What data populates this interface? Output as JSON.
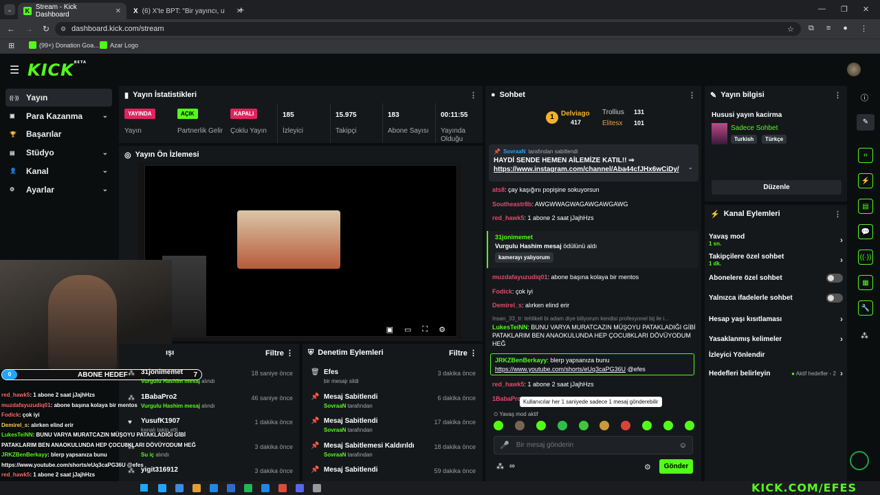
{
  "browser": {
    "tabs": [
      {
        "label": "Stream - Kick Dashboard"
      },
      {
        "label": "(6) X'te BPT: \"Bir yayıncı, uyuma"
      }
    ],
    "url": "dashboard.kick.com/stream",
    "bookmarks": [
      "(99+) Donation Goa...",
      "Azar Logo"
    ]
  },
  "brand": {
    "logo": "KICK",
    "beta": "BETA",
    "accent": "#53fc18"
  },
  "sidebar": {
    "items": [
      {
        "label": "Yayın",
        "icon": "broadcast-icon",
        "active": true,
        "expand": false
      },
      {
        "label": "Para Kazanma",
        "icon": "money-icon",
        "expand": true
      },
      {
        "label": "Başarılar",
        "icon": "trophy-icon",
        "expand": false
      },
      {
        "label": "Stüdyo",
        "icon": "studio-icon",
        "expand": true
      },
      {
        "label": "Kanal",
        "icon": "user-icon",
        "expand": true
      },
      {
        "label": "Ayarlar",
        "icon": "gear-icon",
        "expand": true
      }
    ]
  },
  "stats": {
    "title": "Yayın İstatistikleri",
    "items": [
      {
        "badge": "YAYINDA",
        "label": "Yayın",
        "badge_color": "#e0245e"
      },
      {
        "badge": "AÇIK",
        "label": "Partnerlik Gelir",
        "badge_color": "#53fc18"
      },
      {
        "badge": "KAPALI",
        "label": "Çoklu Yayın",
        "badge_color": "#e0245e"
      },
      {
        "value": "185",
        "label": "İzleyici"
      },
      {
        "value": "15.975",
        "label": "Takipçi"
      },
      {
        "value": "183",
        "label": "Abone Sayısı"
      },
      {
        "value": "00:11:55",
        "label": "Yayında Olduğu"
      }
    ]
  },
  "preview": {
    "title": "Yayın Ön İzlemesi"
  },
  "activity": {
    "title": "ışı",
    "filter": "Filtre",
    "rows": [
      {
        "user": "31jonimemet",
        "detail_hl": "Vurgulu Hashim mesaj",
        "detail": " alındı",
        "time": "18 saniye önce"
      },
      {
        "user": "1BabaPro2",
        "detail_hl": "Vurgulu Hashim mesaj",
        "detail": " alındı",
        "time": "46 saniye önce"
      },
      {
        "user": "YusufK1907",
        "detail_hl": "",
        "detail": "kanalı takip etti",
        "time": "1 dakika önce"
      },
      {
        "user": "",
        "detail_hl": "Su iç",
        "detail": " alındı",
        "time": "3 dakika önce"
      },
      {
        "user": "yigit316912",
        "detail_hl": "",
        "detail": "",
        "time": "3 dakika önce"
      }
    ]
  },
  "moderation": {
    "title": "Denetim Eylemleri",
    "filter": "Filtre",
    "rows": [
      {
        "title": "Efes",
        "sub_hl": "",
        "sub": "bir mesajı sildi",
        "time": "3 dakika önce"
      },
      {
        "title": "Mesaj Sabitlendi",
        "sub_hl": "SovraaN",
        "sub": " tarafından",
        "time": "6 dakika önce"
      },
      {
        "title": "Mesaj Sabitlendi",
        "sub_hl": "SovraaN",
        "sub": " tarafından",
        "time": "17 dakika önce"
      },
      {
        "title": "Mesaj Sabitlemesi Kaldırıldı",
        "sub_hl": "SovraaN",
        "sub": " tarafından",
        "time": "18 dakika önce"
      },
      {
        "title": "Mesaj Sabitlendi",
        "sub_hl": "",
        "sub": "",
        "time": "59 dakika önce"
      }
    ]
  },
  "chat": {
    "title": "Sohbet",
    "leaders": [
      {
        "rank": "1",
        "name": "Delviago",
        "count": "417"
      },
      {
        "name": "Trollius",
        "count": "131"
      },
      {
        "name": "Elitesx",
        "count": "101"
      }
    ],
    "pinned_by": "SovraaN",
    "pinned_by_suffix": " tarafından sabitlendi",
    "pinned_text": "HAYDİ SENDE HEMEN AİLEMİZE KATIL!! ⇒",
    "pinned_link": "https://www.instagram.com/channel/Aba44cfJHx6wCiDy/",
    "messages": [
      {
        "user": "ats8",
        "color": "#e04a6c",
        "text": "çay kaşığını popişine sokuyorsun"
      },
      {
        "user": "Southeastr8b",
        "color": "#e04a6c",
        "text": "AWGWWAGWAGAWGAWGAWG"
      },
      {
        "user": "red_hawk5",
        "color": "#e04a6c",
        "text": "1 abone 2 saat jJajhHzs"
      }
    ],
    "highlight_user": "31jonimemet",
    "highlight_text": "Vurgulu Hashim mesaj",
    "highlight_suffix": " ödülünü aldı",
    "highlight_tag": "kamerayı yalıyorum",
    "messages2": [
      {
        "user": "muzdafayuzudiq01",
        "color": "#e04a6c",
        "text": "abone başına kolaya bir mentos"
      },
      {
        "user": "Fodick",
        "color": "#e04a6c",
        "text": "çok iyi"
      },
      {
        "user": "Demirel_s",
        "color": "#e04a6c",
        "text": "alırken elind erir"
      }
    ],
    "reply_ref": "Insan_33_tr: tehlikeli bi adam diye biliyorum kendisi profesyonel bij ile i...",
    "reply_user": "LukesTeiNN",
    "reply_text": "BUNU VARYA MURATCAZIN MÜŞOYU PATAKLADIĞI GİBİ PATAKLARIM BEN ANAOKULUNDA HEP ÇOCU8KLARI DÖVÜYODUM HEĞ",
    "green_user": "JRKZBenBerkayy",
    "green_text": "blerp yapsanıza bunu",
    "green_link": "https://www.youtube.com/shorts/eUq3caPG36U",
    "green_suffix": " @efes",
    "last_user": "red_hawk5",
    "last_text": "1 abone 2 saat jJajhHzs",
    "cut_user": "1BabaPro",
    "tooltip": "Kullanıcılar her 1 saniyede sadece 1 mesaj gönderebilir",
    "slowmode": "Yavaş mod aktif",
    "input_placeholder": "Bir mesaj gönderin",
    "send": "Gönder"
  },
  "stream_info": {
    "title": "Yayın bilgisi",
    "stream_title": "Hususi yayın kacirma",
    "category": "Sadece Sohbet",
    "tags": [
      "Turkish",
      "Türkçe"
    ],
    "edit": "Düzenle"
  },
  "channel_actions": {
    "title": "Kanal Eylemleri",
    "rows": [
      {
        "label": "Yavaş mod",
        "sub": "1 sn.",
        "control": "chevron"
      },
      {
        "label": "Takipçilere özel sohbet",
        "sub": "1 dk.",
        "control": "chevron"
      },
      {
        "label": "Abonelere özel sohbet",
        "sub": "",
        "control": "toggle"
      },
      {
        "label": "Yalnızca ifadelerle sohbet",
        "sub": "",
        "control": "toggle"
      },
      {
        "label": "Hesap yaşı kısıtlaması",
        "sub": "",
        "control": "chevron"
      },
      {
        "label": "Yasaklanmış kelimeler",
        "sub": "",
        "control": "chevron"
      },
      {
        "label": "İzleyici Yönlendir",
        "sub": "",
        "control": "none"
      },
      {
        "label": "Hedefleri belirleyin",
        "sub": "",
        "control": "chevron",
        "status": "Aktif hedefler - 2"
      }
    ]
  },
  "overlay": {
    "goal_count": "0",
    "goal_label": "ABONE HEDEF",
    "goal_target": "7",
    "lines": [
      {
        "user": "red_hawk5",
        "text": ": 1 abone 2 saat jJajhHzs",
        "color": "#ff6b6b"
      },
      {
        "user": "muzdafayuzudiq01",
        "text": ": abone başına kolaya bir mentos",
        "color": "#ff6b6b"
      },
      {
        "user": "Fodick",
        "text": ": çok iyi",
        "color": "#ff6b6b"
      },
      {
        "user": "Demirel_s",
        "text": ": alırken elind erir",
        "color": "#ffd34d"
      },
      {
        "user": "LukesTeiNN",
        "text": ": BUNU VARYA MURATCAZIN MÜŞOYU PATAKLADIĞI GİBİ",
        "color": "#53fc18"
      },
      {
        "user": "",
        "text": "PATAKLARIM BEN ANAOKULUNDA HEP ÇOCU8KLARI DÖVÜYODUM HEĞ",
        "color": "#fff"
      },
      {
        "user": "JRKZBenBerkayy",
        "text": ": blerp yapsanıza bunu",
        "color": "#53fc18"
      },
      {
        "user": "",
        "text": "https://www.youtube.com/shorts/eUq3caPG36U @efes",
        "color": "#fff"
      },
      {
        "user": "red_hawk5",
        "text": ": 1 abone 2 saat jJajhHzs",
        "color": "#ff6b6b"
      }
    ],
    "watermark": "KICK.COM/EFES"
  }
}
